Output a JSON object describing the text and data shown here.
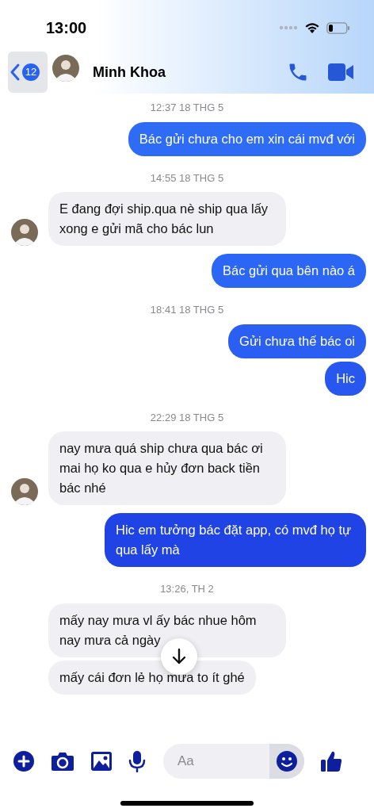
{
  "status_bar": {
    "time": "13:00"
  },
  "header": {
    "back_badge": "12",
    "contact_name": "Minh Khoa"
  },
  "messages": [
    {
      "kind": "timestamp",
      "text": "12:37 18 THG 5"
    },
    {
      "kind": "outgoing",
      "bubbles": [
        "Bác gửi chưa cho em xin cái mvđ với"
      ]
    },
    {
      "kind": "timestamp",
      "text": "14:55 18 THG 5"
    },
    {
      "kind": "incoming",
      "avatar_shown": true,
      "bubbles": [
        "E đang đợi ship.qua nè ship qua lấy xong e gửi mã cho bác lun"
      ]
    },
    {
      "kind": "outgoing",
      "bubbles": [
        "Bác gửi qua bên nào á"
      ]
    },
    {
      "kind": "timestamp",
      "text": "18:41 18 THG 5"
    },
    {
      "kind": "outgoing",
      "bubbles": [
        "Gửi chưa thế bác oi",
        "Hic"
      ]
    },
    {
      "kind": "timestamp",
      "text": "22:29 18 THG 5"
    },
    {
      "kind": "incoming",
      "avatar_shown": true,
      "bubbles": [
        "nay mưa quá ship chưa qua bác ơi mai họ ko qua e hủy đơn back tiền bác nhé"
      ]
    },
    {
      "kind": "outgoing",
      "bubbles": [
        "Hic em tưởng bác đặt app, có mvđ họ tự qua lấy mà"
      ]
    },
    {
      "kind": "timestamp",
      "text": "13:26, TH 2"
    },
    {
      "kind": "incoming",
      "avatar_shown": false,
      "bubbles": [
        "mấy nay mưa vl ấy bác nhue hôm nay mưa cả ngày",
        "mấy cái đơn lẻ họ mưa to ít ghé"
      ]
    }
  ],
  "composer": {
    "placeholder": "Aa"
  }
}
